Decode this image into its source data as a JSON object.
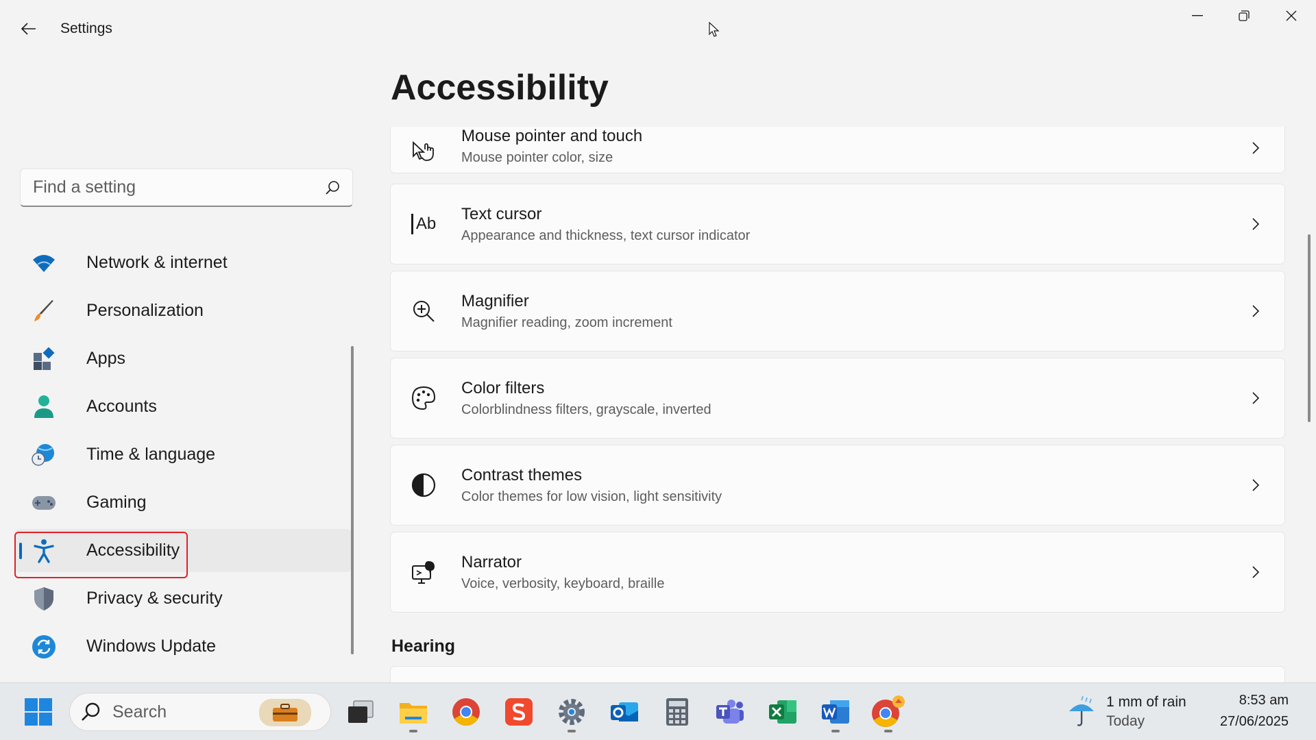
{
  "window": {
    "title": "Settings"
  },
  "sidebar": {
    "search": {
      "placeholder": "Find a setting"
    },
    "items": [
      {
        "label": "Network & internet",
        "icon": "wifi-icon"
      },
      {
        "label": "Personalization",
        "icon": "brush-icon"
      },
      {
        "label": "Apps",
        "icon": "apps-icon"
      },
      {
        "label": "Accounts",
        "icon": "person-icon"
      },
      {
        "label": "Time & language",
        "icon": "globe-clock-icon"
      },
      {
        "label": "Gaming",
        "icon": "gamepad-icon"
      },
      {
        "label": "Accessibility",
        "icon": "accessibility-icon",
        "selected": true
      },
      {
        "label": "Privacy & security",
        "icon": "shield-icon"
      },
      {
        "label": "Windows Update",
        "icon": "update-icon"
      }
    ]
  },
  "main": {
    "title": "Accessibility",
    "cards": [
      {
        "title": "Mouse pointer and touch",
        "subtitle": "Mouse pointer color, size",
        "icon": "pointer-touch-icon"
      },
      {
        "title": "Text cursor",
        "subtitle": "Appearance and thickness, text cursor indicator",
        "icon": "text-cursor-icon"
      },
      {
        "title": "Magnifier",
        "subtitle": "Magnifier reading, zoom increment",
        "icon": "magnifier-icon"
      },
      {
        "title": "Color filters",
        "subtitle": "Colorblindness filters, grayscale, inverted",
        "icon": "palette-icon"
      },
      {
        "title": "Contrast themes",
        "subtitle": "Color themes for low vision, light sensitivity",
        "icon": "contrast-icon"
      },
      {
        "title": "Narrator",
        "subtitle": "Voice, verbosity, keyboard, braille",
        "icon": "narrator-icon"
      }
    ],
    "section_hearing": "Hearing",
    "text_cursor_glyph": "Ab"
  },
  "taskbar": {
    "search_label": "Search",
    "apps": [
      "start-icon",
      "task-view-icon",
      "file-explorer-icon",
      "chrome-icon",
      "wps-icon",
      "settings-icon",
      "outlook-icon",
      "calculator-icon",
      "teams-icon",
      "excel-icon",
      "word-icon",
      "chrome-profile-icon"
    ],
    "weather": {
      "line1": "1 mm of rain",
      "line2": "Today"
    },
    "clock": {
      "time": "8:53 am",
      "date": "27/06/2025"
    }
  },
  "colors": {
    "accent": "#0067c0",
    "highlight": "#e0202a",
    "background": "#f3f3f3",
    "card": "#fbfbfb"
  }
}
